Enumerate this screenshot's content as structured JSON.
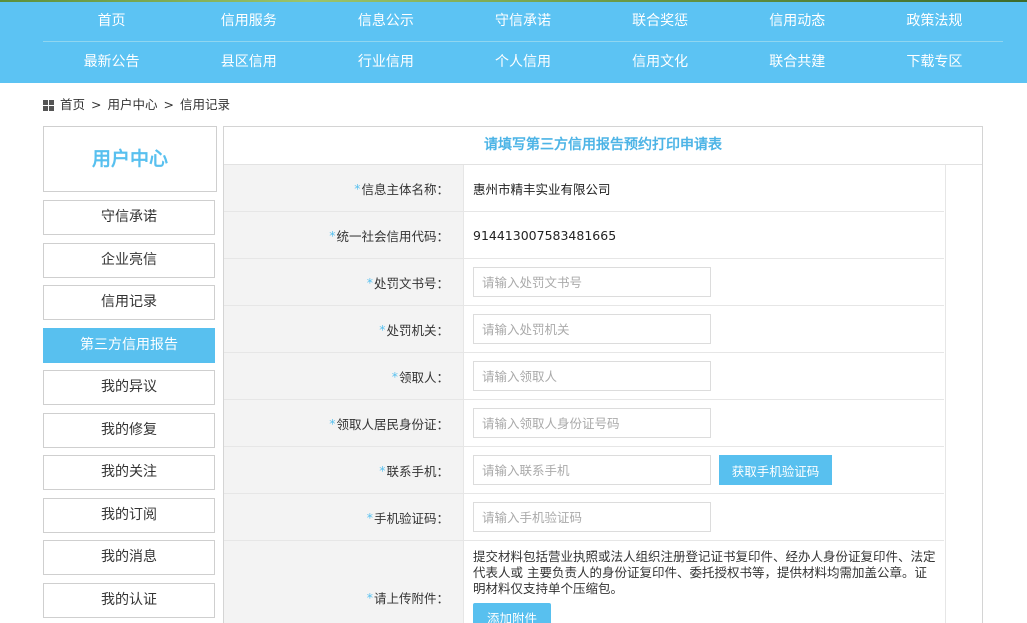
{
  "nav": {
    "row1": [
      "首页",
      "信用服务",
      "信息公示",
      "守信承诺",
      "联合奖惩",
      "信用动态",
      "政策法规"
    ],
    "row2": [
      "最新公告",
      "县区信用",
      "行业信用",
      "个人信用",
      "信用文化",
      "联合共建",
      "下载专区"
    ]
  },
  "breadcrumb": {
    "home": "首页",
    "sep": ">",
    "user_center": "用户中心",
    "current": "信用记录"
  },
  "sidebar": {
    "title": "用户中心",
    "items": [
      "守信承诺",
      "企业亮信",
      "信用记录",
      "第三方信用报告",
      "我的异议",
      "我的修复",
      "我的关注",
      "我的订阅",
      "我的消息",
      "我的认证"
    ],
    "active_index": 3
  },
  "form": {
    "title": "请填写第三方信用报告预约打印申请表",
    "star": "*",
    "entity_label": "信息主体名称：",
    "entity_value": "惠州市精丰实业有限公司",
    "credit_code_label": "统一社会信用代码：",
    "credit_code_value": "914413007583481665",
    "penalty_no_label": "处罚文书号：",
    "penalty_no_placeholder": "请输入处罚文书号",
    "penalty_org_label": "处罚机关：",
    "penalty_org_placeholder": "请输入处罚机关",
    "receiver_label": "领取人：",
    "receiver_placeholder": "请输入领取人",
    "receiver_id_label": "领取人居民身份证：",
    "receiver_id_placeholder": "请输入领取人身份证号码",
    "phone_label": "联系手机：",
    "phone_placeholder": "请输入联系手机",
    "get_code_button": "获取手机验证码",
    "code_label": "手机验证码：",
    "code_placeholder": "请输入手机验证码",
    "attach_label": "请上传附件：",
    "attach_note": "提交材料包括营业执照或法人组织注册登记证书复印件、经办人身份证复印件、法定代表人或 主要负责人的身份证复印件、委托授权书等，提供材料均需加盖公章。证明材料仅支持单个压缩包。",
    "attach_button": "添加附件"
  },
  "colors": {
    "accent": "#58c0ef",
    "nav_bg": "#5cc3f3",
    "label_bg": "#f3f3f3"
  }
}
